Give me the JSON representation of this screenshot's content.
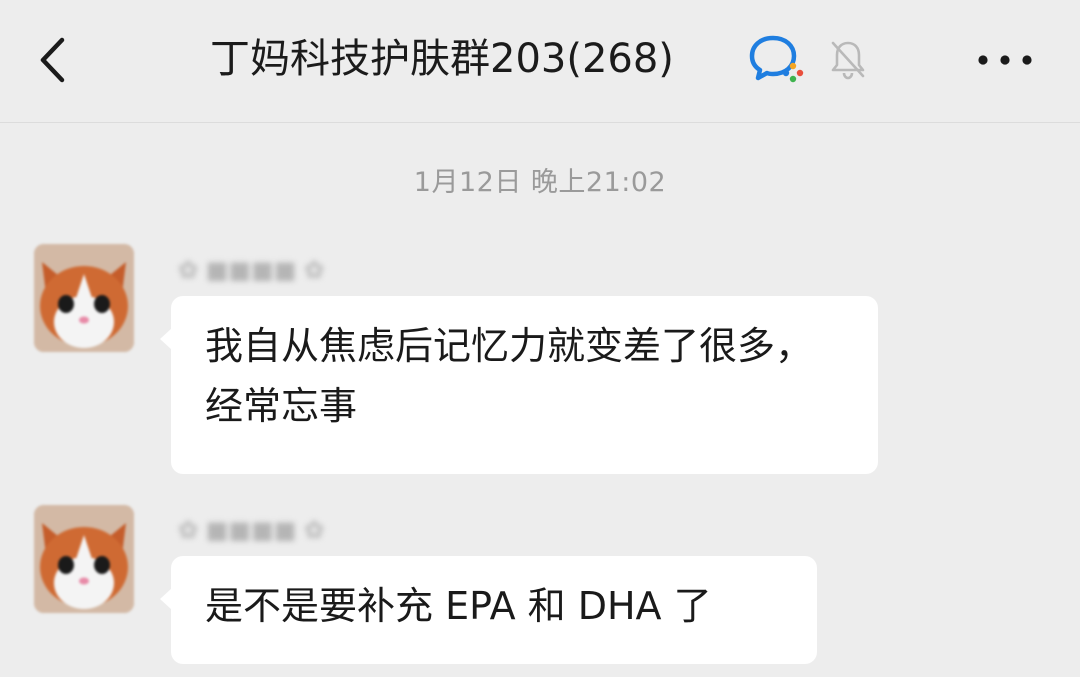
{
  "header": {
    "back_icon": "chevron-left-icon",
    "title": "丁妈科技护肤群203(268)",
    "app_badge_icon": "wecom-chat-icon",
    "mute_icon": "bell-off-icon",
    "more_icon": "more-dots-icon"
  },
  "chat": {
    "timestamp": "1月12日 晚上21:02",
    "messages": [
      {
        "avatar_icon": "cat-avatar-icon",
        "sender": "✿ ■■■■ ✿",
        "text": "我自从焦虑后记忆力就变差了很多，经常忘事"
      },
      {
        "avatar_icon": "cat-avatar-icon",
        "sender": "✿ ■■■■ ✿",
        "text": "是不是要补充 EPA 和 DHA 了"
      }
    ]
  },
  "colors": {
    "background": "#ededed",
    "bubble": "#ffffff",
    "timestamp_text": "#9a9a9a",
    "title_text": "#1b1b1b"
  }
}
